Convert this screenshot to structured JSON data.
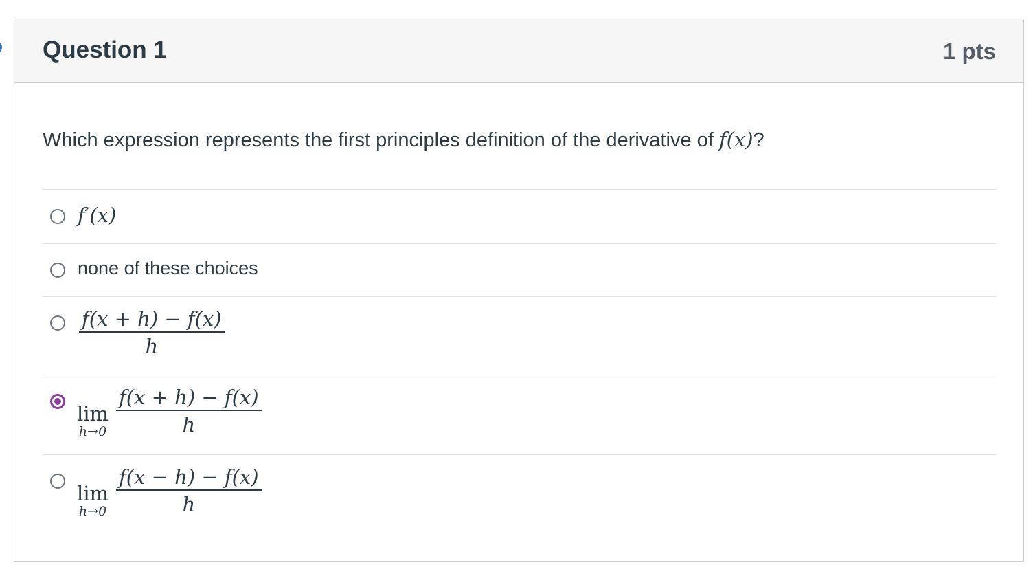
{
  "question": {
    "title": "Question 1",
    "points": "1 pts",
    "prompt_text": "Which expression represents the first principles definition of the derivative of ",
    "prompt_math": "f(x)",
    "prompt_end": "?"
  },
  "answers": [
    {
      "kind": "math",
      "label": "f′(x)",
      "selected": false
    },
    {
      "kind": "text",
      "label": "none of these choices",
      "selected": false
    },
    {
      "kind": "fraction",
      "numerator": "f(x + h) − f(x)",
      "denominator": "h",
      "selected": false
    },
    {
      "kind": "limit",
      "lim_word": "lim",
      "lim_sub": "h→0",
      "numerator": "f(x + h) − f(x)",
      "denominator": "h",
      "selected": true
    },
    {
      "kind": "limit",
      "lim_word": "lim",
      "lim_sub": "h→0",
      "numerator": "f(x − h) − f(x)",
      "denominator": "h",
      "selected": false
    }
  ],
  "colors": {
    "accent": "#8b3f98",
    "header_bg": "#f5f5f5",
    "border": "#c7cdd1",
    "text": "#2d3b45"
  }
}
